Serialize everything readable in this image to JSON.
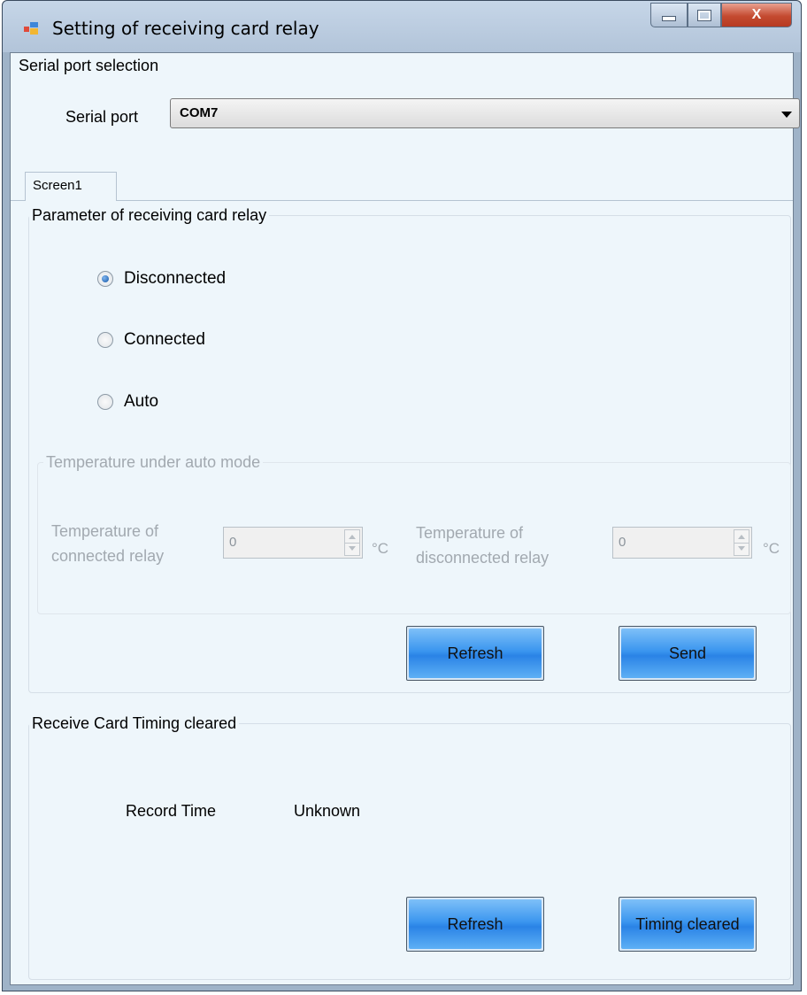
{
  "window": {
    "title": "Setting of receiving card relay",
    "controls": {
      "minimize": "minimize",
      "maximize": "maximize",
      "close": "X"
    }
  },
  "serial": {
    "group_label": "Serial port selection",
    "port_label": "Serial port",
    "selected_port": "COM7"
  },
  "tabs": [
    {
      "label": "Screen1",
      "active": true
    }
  ],
  "relay": {
    "group_label": "Parameter of receiving card relay",
    "options": [
      {
        "label": "Disconnected",
        "checked": true
      },
      {
        "label": "Connected",
        "checked": false
      },
      {
        "label": "Auto",
        "checked": false
      }
    ],
    "auto_mode": {
      "group_label": "Temperature under auto mode",
      "connected_label_line1": "Temperature of",
      "connected_label_line2": "connected relay",
      "connected_value": "0",
      "disconnected_label_line1": "Temperature of",
      "disconnected_label_line2": "disconnected relay",
      "disconnected_value": "0",
      "unit": "°C"
    },
    "refresh_label": "Refresh",
    "send_label": "Send"
  },
  "timing": {
    "group_label": "Receive Card Timing cleared",
    "record_label": "Record Time",
    "record_value": "Unknown",
    "refresh_label": "Refresh",
    "clear_label": "Timing cleared"
  },
  "colors": {
    "client_bg": "#eef6fb",
    "button_blue": "#3b96ef",
    "close_red": "#c44a30",
    "disabled_text": "#a2a9b0"
  }
}
